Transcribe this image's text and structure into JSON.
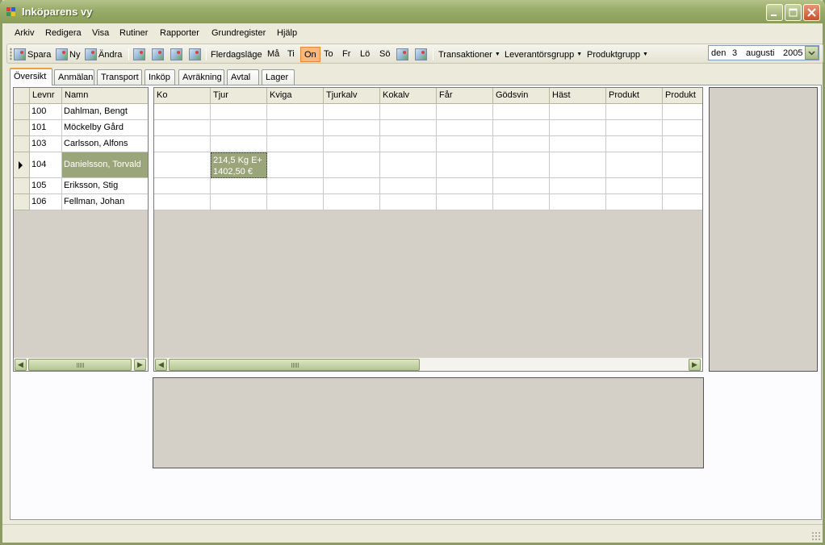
{
  "window": {
    "title": "Inköparens vy"
  },
  "menu": [
    {
      "label": "Arkiv"
    },
    {
      "label": "Redigera"
    },
    {
      "label": "Visa"
    },
    {
      "label": "Rutiner"
    },
    {
      "label": "Rapporter"
    },
    {
      "label": "Grundregister"
    },
    {
      "label": "Hjälp"
    }
  ],
  "toolbar": {
    "save_label": "Spara",
    "new_label": "Ny",
    "edit_label": "Ändra",
    "multiday_label": "Flerdagsläge",
    "days": [
      "Må",
      "Ti",
      "On",
      "To",
      "Fr",
      "Lö",
      "Sö"
    ],
    "active_day": "On",
    "transactions_label": "Transaktioner",
    "supplier_group_label": "Leverantörsgrupp",
    "product_group_label": "Produktgrupp",
    "date": {
      "prefix": "den",
      "day": "3",
      "month": "augusti",
      "year": "2005"
    }
  },
  "tabs": [
    "Översikt",
    "Anmälan",
    "Transport",
    "Inköp",
    "Avräkning",
    "Avtal",
    "Lager"
  ],
  "active_tab": "Översikt",
  "supplier_grid": {
    "columns": [
      "Levnr",
      "Namn"
    ],
    "rows": [
      {
        "levnr": "100",
        "namn": "Dahlman, Bengt"
      },
      {
        "levnr": "101",
        "namn": "Möckelby Gård"
      },
      {
        "levnr": "103",
        "namn": "Carlsson, Alfons"
      },
      {
        "levnr": "104",
        "namn": "Danielsson, Torvald"
      },
      {
        "levnr": "105",
        "namn": "Eriksson, Stig"
      },
      {
        "levnr": "106",
        "namn": "Fellman, Johan"
      }
    ],
    "selected_row": "104"
  },
  "product_grid": {
    "columns": [
      "Ko",
      "Tjur",
      "Kviga",
      "Tjurkalv",
      "Kokalv",
      "Får",
      "Gödsvin",
      "Häst",
      "Produkt",
      "Produkt"
    ],
    "highlight_cell": {
      "row": "104",
      "column": "Tjur",
      "line1": "214,5 Kg E+",
      "line2": "1402,50 €"
    }
  }
}
